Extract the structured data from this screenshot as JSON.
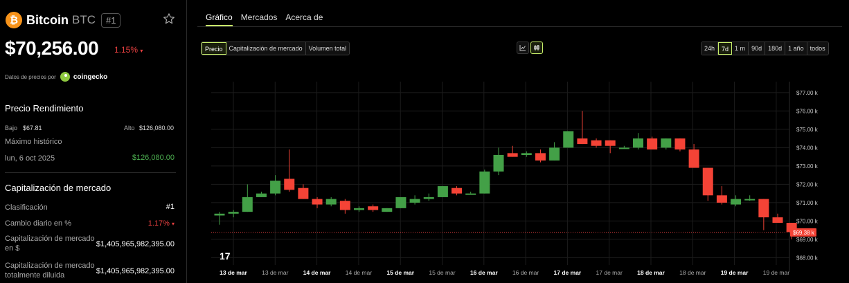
{
  "coin": {
    "name": "Bitcoin",
    "symbol": "BTC",
    "rank_badge": "#1",
    "logo_glyph": "₿",
    "price": "$70,256.00",
    "change": "1.15%",
    "change_arrow": "▾"
  },
  "provider": {
    "label": "Datos de precios por",
    "name": "coingecko"
  },
  "performance": {
    "title": "Precio Rendimiento",
    "low_label": "Bajo",
    "low_value": "$67.81",
    "high_label": "Alto",
    "high_value": "$126,080.00",
    "ath_label": "Máximo histórico",
    "ath_date": "lun, 6 oct 2025",
    "ath_value": "$126,080.00"
  },
  "market_cap": {
    "title": "Capitalización de mercado",
    "rows": [
      {
        "label": "Clasificación",
        "value": "#1"
      },
      {
        "label": "Cambio diario en %",
        "value": "1.17%",
        "arrow": "▾"
      },
      {
        "label_line1": "Capitalización de mercado",
        "label_line2": "en $",
        "value": "$1,405,965,982,395.00"
      },
      {
        "label_line1": "Capitalización de mercado",
        "label_line2": "totalmente diluida",
        "value": "$1,405,965,982,395.00"
      }
    ]
  },
  "tabs": [
    "Gráfico",
    "Mercados",
    "Acerca de"
  ],
  "metric_buttons": [
    "Precio",
    "Capitalización de mercado",
    "Volumen total"
  ],
  "range_buttons": [
    "24h",
    "7d",
    "1 m",
    "90d",
    "180d",
    "1 año",
    "todos"
  ],
  "icons": {
    "line": "line-chart-icon",
    "candle": "candlestick-icon",
    "star": "star-icon"
  },
  "colors": {
    "up": "#43a047",
    "down": "#f44336",
    "accent": "#c8f06a",
    "red_text": "#e84040",
    "green_text": "#4caf50"
  },
  "chart_data": {
    "type": "candlestick",
    "y_ticks": [
      "$68.00 k",
      "$69.00 k",
      "$70.00 k",
      "$71.00 k",
      "$72.00 k",
      "$73.00 k",
      "$74.00 k",
      "$75.00 k",
      "$76.00 k",
      "$77.00 k"
    ],
    "y_tick_values": [
      68,
      69,
      70,
      71,
      72,
      73,
      74,
      75,
      76,
      77
    ],
    "ylim": [
      67.6,
      77.6
    ],
    "x_labels": [
      {
        "text": "13 de mar",
        "bold": true
      },
      {
        "text": "13 de mar",
        "bold": false
      },
      {
        "text": "14 de mar",
        "bold": true
      },
      {
        "text": "14 de mar",
        "bold": false
      },
      {
        "text": "15 de mar",
        "bold": true
      },
      {
        "text": "15 de mar",
        "bold": false
      },
      {
        "text": "16 de mar",
        "bold": true
      },
      {
        "text": "16 de mar",
        "bold": false
      },
      {
        "text": "17 de mar",
        "bold": true
      },
      {
        "text": "17 de mar",
        "bold": false
      },
      {
        "text": "18 de mar",
        "bold": true
      },
      {
        "text": "18 de mar",
        "bold": false
      },
      {
        "text": "19 de mar",
        "bold": true
      },
      {
        "text": "19 de mar",
        "bold": false
      }
    ],
    "current_price_label": "$69.38 k",
    "current_price": 69.38,
    "candles": [
      [
        70.3,
        70.4,
        69.8,
        70.5
      ],
      [
        70.4,
        70.5,
        70.2,
        70.6
      ],
      [
        70.5,
        71.3,
        70.5,
        72.0
      ],
      [
        71.3,
        71.5,
        71.3,
        71.6
      ],
      [
        71.5,
        72.2,
        71.4,
        72.5
      ],
      [
        72.3,
        71.7,
        71.6,
        73.9
      ],
      [
        71.8,
        71.2,
        71.2,
        72.0
      ],
      [
        71.2,
        70.9,
        70.7,
        71.3
      ],
      [
        70.9,
        71.2,
        70.8,
        71.3
      ],
      [
        71.1,
        70.6,
        70.4,
        71.2
      ],
      [
        70.6,
        70.7,
        70.5,
        70.8
      ],
      [
        70.8,
        70.6,
        70.5,
        70.9
      ],
      [
        70.5,
        70.7,
        70.5,
        70.7
      ],
      [
        70.7,
        71.3,
        70.7,
        71.3
      ],
      [
        71.0,
        71.2,
        70.9,
        71.4
      ],
      [
        71.2,
        71.3,
        71.1,
        71.5
      ],
      [
        71.3,
        71.9,
        71.3,
        71.9
      ],
      [
        71.8,
        71.5,
        71.4,
        71.9
      ],
      [
        71.5,
        71.5,
        71.5,
        71.6
      ],
      [
        71.5,
        72.7,
        71.5,
        72.8
      ],
      [
        72.7,
        73.6,
        72.5,
        74.0
      ],
      [
        73.7,
        73.5,
        73.5,
        74.1
      ],
      [
        73.6,
        73.7,
        73.5,
        73.8
      ],
      [
        73.7,
        73.3,
        73.2,
        73.9
      ],
      [
        73.3,
        74.0,
        73.3,
        74.3
      ],
      [
        74.0,
        74.9,
        74.0,
        74.9
      ],
      [
        74.5,
        74.2,
        74.2,
        76.0
      ],
      [
        74.4,
        74.1,
        74.0,
        74.5
      ],
      [
        74.4,
        74.1,
        73.7,
        74.4
      ],
      [
        74.0,
        74.0,
        74.0,
        74.1
      ],
      [
        74.0,
        74.5,
        73.9,
        74.8
      ],
      [
        74.5,
        73.9,
        73.9,
        74.6
      ],
      [
        74.0,
        74.5,
        73.9,
        74.5
      ],
      [
        74.5,
        73.9,
        73.8,
        74.5
      ],
      [
        73.9,
        72.9,
        72.9,
        74.2
      ],
      [
        72.9,
        71.4,
        71.1,
        72.9
      ],
      [
        71.4,
        71.0,
        70.9,
        71.9
      ],
      [
        70.9,
        71.2,
        70.8,
        71.4
      ],
      [
        71.2,
        71.2,
        71.1,
        71.4
      ],
      [
        71.2,
        70.2,
        69.5,
        71.2
      ],
      [
        70.2,
        69.9,
        69.9,
        70.4
      ],
      [
        69.9,
        69.4,
        69.0,
        69.9
      ]
    ]
  }
}
